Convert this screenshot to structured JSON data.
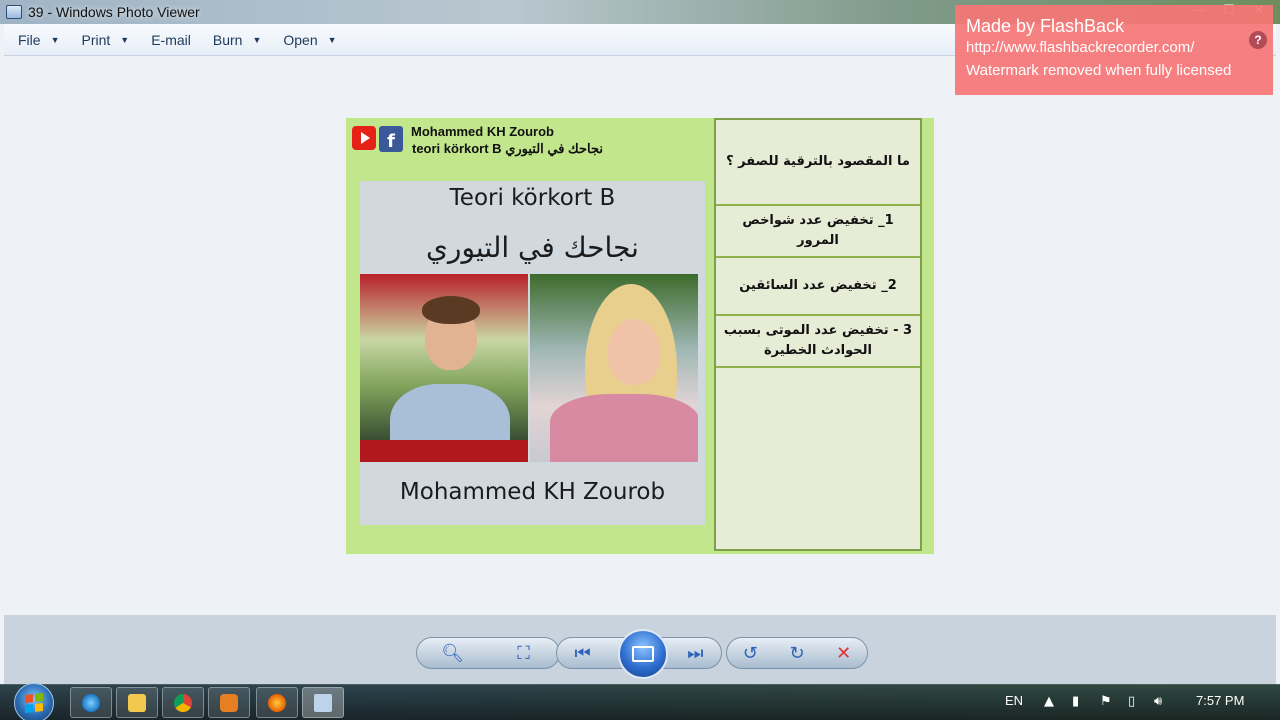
{
  "window": {
    "title": "39 - Windows Photo Viewer",
    "controls": [
      "—",
      "☐",
      "✕"
    ]
  },
  "menu": [
    {
      "label": "File",
      "has_dropdown": true
    },
    {
      "label": "Print",
      "has_dropdown": true
    },
    {
      "label": "E-mail",
      "has_dropdown": false
    },
    {
      "label": "Burn",
      "has_dropdown": true
    },
    {
      "label": "Open",
      "has_dropdown": true
    }
  ],
  "watermark": {
    "title": "Made by FlashBack",
    "url": "http://www.flashbackrecorder.com/",
    "note": "Watermark removed when fully licensed",
    "help_icon": "?"
  },
  "photo": {
    "channel_name": "Mohammed KH Zourob",
    "channel_sub": "teori körkort B نجاحك في التيوري",
    "card_title": "Teori körkort B",
    "card_arabic": "نجاحك في التيوري",
    "card_footer": "Mohammed KH Zourob",
    "question": "ما المقصود بالترقية للصفر ؟",
    "answers": [
      "1_  تخفيض عدد شواخص المرور",
      "2_  تخفيض عدد السائقين",
      "3 - تخفيض عدد الموتى بسبب الحوادث الخطيرة"
    ]
  },
  "controls": {
    "zoom_icon": "magnifier-icon",
    "fit_icon": "actual-size-icon",
    "prev_icon": "previous-icon",
    "slideshow_icon": "slideshow-icon",
    "next_icon": "next-icon",
    "rotate_ccw_icon": "rotate-counterclockwise-icon",
    "rotate_cw_icon": "rotate-clockwise-icon",
    "delete_icon": "delete-icon"
  },
  "taskbar": {
    "language": "EN",
    "time": "7:57 PM"
  },
  "colors": {
    "photo_bg": "#c2e68b",
    "watermark_bg": "#f67676",
    "menu_text": "#1e395b"
  }
}
